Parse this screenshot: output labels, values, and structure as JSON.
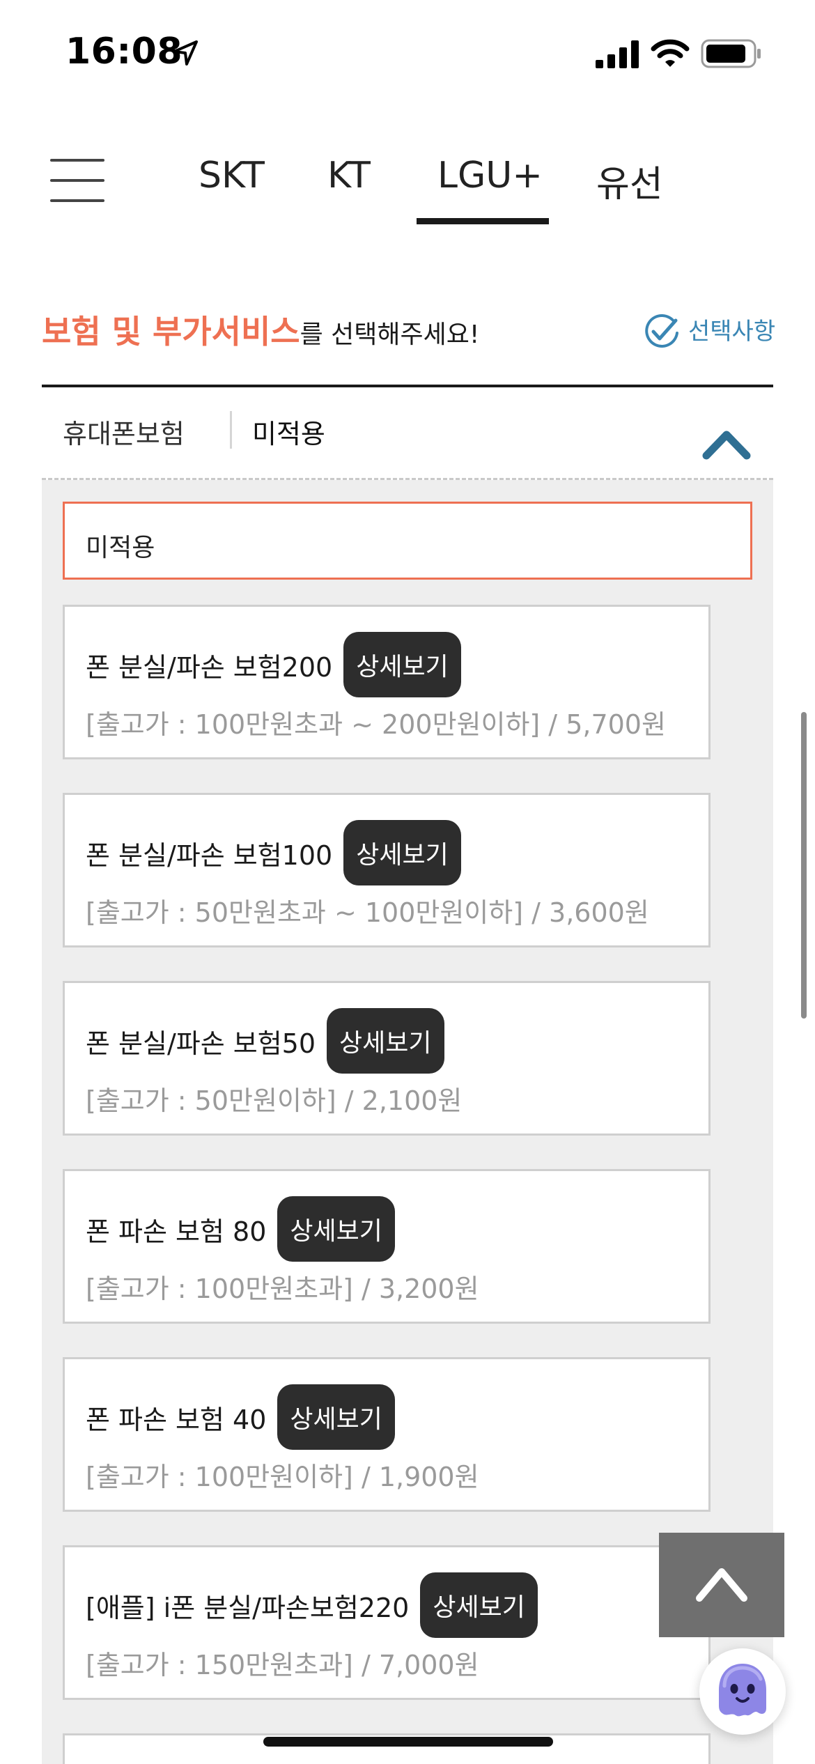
{
  "status_bar": {
    "time": "16:08"
  },
  "carrier_tabs": [
    {
      "label": "SKT"
    },
    {
      "label": "KT"
    },
    {
      "label": "LGU+",
      "active": true
    },
    {
      "label": "유선"
    }
  ],
  "section": {
    "title_accent": "보험 및 부가서비스",
    "title_rest": "를 선택해주세요!",
    "selected_link": "선택사항"
  },
  "accordion": {
    "label": "휴대폰보험",
    "value": "미적용"
  },
  "options": {
    "selected_option": "미적용",
    "detail_button_label": "상세보기",
    "items": [
      {
        "title": "폰 분실/파손 보험200",
        "subtitle": "[출고가 : 100만원초과 ~ 200만원이하] / 5,700원"
      },
      {
        "title": "폰 분실/파손 보험100",
        "subtitle": "[출고가 : 50만원초과 ~ 100만원이하] / 3,600원"
      },
      {
        "title": "폰 분실/파손 보험50",
        "subtitle": "[출고가 : 50만원이하] / 2,100원"
      },
      {
        "title": "폰 파손 보험 80",
        "subtitle": "[출고가 : 100만원초과] / 3,200원"
      },
      {
        "title": "폰 파손 보험 40",
        "subtitle": "[출고가 : 100만원이하] / 1,900원"
      },
      {
        "title": "[애플] i폰 분실/파손보험220",
        "subtitle": "[출고가 : 150만원초과] / 7,000원"
      }
    ]
  },
  "colors": {
    "accent": "#ee7052",
    "link_blue": "#3a86b4",
    "detail_button_bg": "#2d2d2d",
    "panel_bg": "#eeeeee"
  },
  "icons": {
    "location": "location-arrow-icon",
    "signal": "cellular-signal-icon",
    "wifi": "wifi-icon",
    "battery": "battery-icon",
    "menu": "hamburger-menu-icon",
    "check": "check-circle-icon",
    "collapse": "chevron-up-icon",
    "scroll_top": "chevron-up-icon",
    "chatbot": "ghost-chatbot-icon"
  }
}
